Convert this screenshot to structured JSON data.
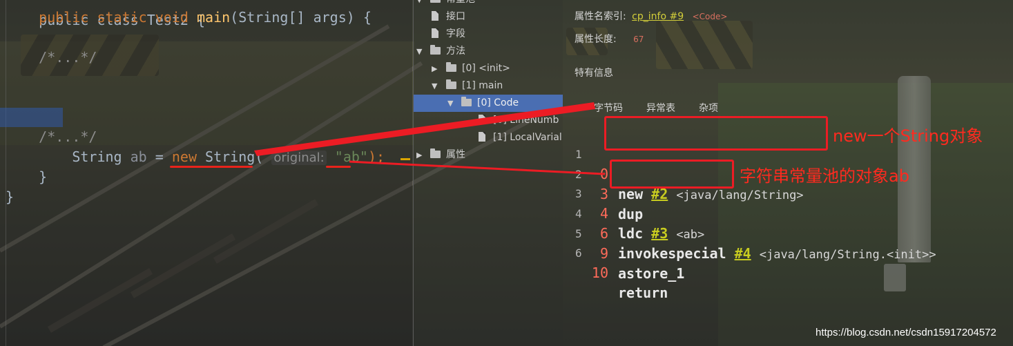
{
  "editor": {
    "lines": {
      "class_decl": "public class Test2 {",
      "main_kw1": "public",
      "main_kw2": "static",
      "main_kw3": "void",
      "main_name": "main",
      "main_rest": "(String[] args) {",
      "fold1": "/*...*/",
      "fold2": "/*...*/",
      "stmt_type": "String",
      "stmt_var": "ab",
      "stmt_eq": "=",
      "stmt_new": "new",
      "stmt_class": "String",
      "stmt_paren": "(",
      "param_hint": "original:",
      "str_literal": "\"ab\"",
      "stmt_end": ");",
      "close_method": "}",
      "close_class": "}"
    }
  },
  "tree": {
    "items": [
      {
        "label": "常量池",
        "kind": "folder",
        "expanded": true
      },
      {
        "label": "接口",
        "kind": "file"
      },
      {
        "label": "字段",
        "kind": "file"
      },
      {
        "label": "方法",
        "kind": "folder",
        "expanded": true
      },
      {
        "label": "[0] <init>",
        "kind": "folder",
        "expanded": false
      },
      {
        "label": "[1] main",
        "kind": "folder",
        "expanded": true
      },
      {
        "label": "[0] Code",
        "kind": "folder",
        "expanded": true,
        "selected": true
      },
      {
        "label": "[0] LineNumb",
        "kind": "file"
      },
      {
        "label": "[1] LocalVarial",
        "kind": "file"
      },
      {
        "label": "属性",
        "kind": "folder",
        "expanded": false
      }
    ]
  },
  "detail": {
    "attr_name_label": "属性名索引:",
    "attr_name_link": "cp_info #9",
    "attr_name_tag": "<Code>",
    "attr_len_label": "属性长度:",
    "attr_len_value": "67",
    "specific_info": "特有信息",
    "tabs": [
      "字节码",
      "异常表",
      "杂项"
    ],
    "bytecode": [
      {
        "line": "1",
        "offset": "0",
        "op": "new",
        "ref": "#2",
        "arg": "<java/lang/String>"
      },
      {
        "line": "2",
        "offset": "3",
        "op": "dup",
        "ref": "",
        "arg": ""
      },
      {
        "line": "3",
        "offset": "4",
        "op": "ldc",
        "ref": "#3",
        "arg": "<ab>"
      },
      {
        "line": "4",
        "offset": "6",
        "op": "invokespecial",
        "ref": "#4",
        "arg": "<java/lang/String.<init>>"
      },
      {
        "line": "5",
        "offset": "9",
        "op": "astore_1",
        "ref": "",
        "arg": ""
      },
      {
        "line": "6",
        "offset": "10",
        "op": "return",
        "ref": "",
        "arg": ""
      }
    ]
  },
  "annotations": {
    "note1": "new一个String对象",
    "note2": "字符串常量池的对象ab",
    "color": "#ec1c24"
  },
  "watermark": "https://blog.csdn.net/csdn15917204572"
}
